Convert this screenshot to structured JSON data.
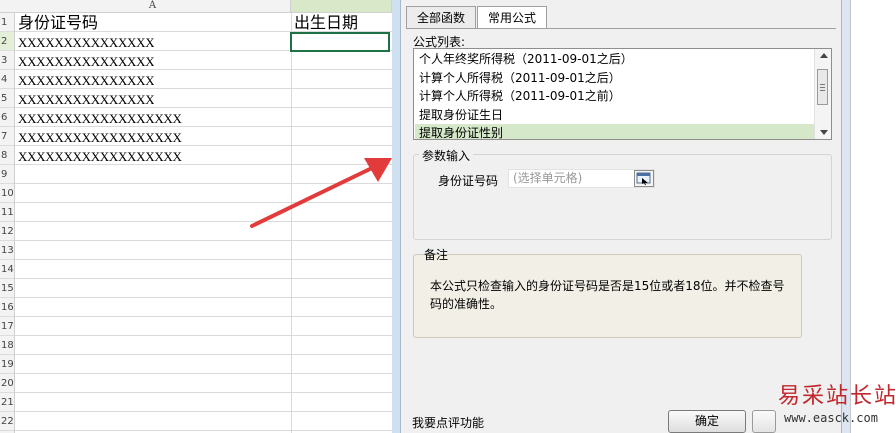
{
  "spreadsheet": {
    "columns": [
      {
        "label": "A",
        "selected": false
      },
      {
        "label": "",
        "selected": true
      }
    ],
    "rows": [
      {
        "num": "1",
        "selected": false
      },
      {
        "num": "2",
        "selected": true
      },
      {
        "num": "3",
        "selected": false
      },
      {
        "num": "4",
        "selected": false
      },
      {
        "num": "5",
        "selected": false
      },
      {
        "num": "6",
        "selected": false
      },
      {
        "num": "7",
        "selected": false
      },
      {
        "num": "8",
        "selected": false
      },
      {
        "num": "9",
        "selected": false
      },
      {
        "num": "10",
        "selected": false
      },
      {
        "num": "11",
        "selected": false
      },
      {
        "num": "12",
        "selected": false
      },
      {
        "num": "13",
        "selected": false
      },
      {
        "num": "14",
        "selected": false
      },
      {
        "num": "15",
        "selected": false
      },
      {
        "num": "16",
        "selected": false
      },
      {
        "num": "17",
        "selected": false
      },
      {
        "num": "18",
        "selected": false
      },
      {
        "num": "19",
        "selected": false
      },
      {
        "num": "20",
        "selected": false
      },
      {
        "num": "21",
        "selected": false
      },
      {
        "num": "22",
        "selected": false
      }
    ],
    "header_a": "身份证号码",
    "header_b": "出生日期",
    "id_values": [
      "XXXXXXXXXXXXXXX",
      "XXXXXXXXXXXXXXX",
      "XXXXXXXXXXXXXXX",
      "XXXXXXXXXXXXXXX",
      "XXXXXXXXXXXXXXXXXX",
      "XXXXXXXXXXXXXXXXXX",
      "XXXXXXXXXXXXXXXXXX"
    ],
    "active_cell_value": ""
  },
  "dialog": {
    "tabs": [
      {
        "label": "全部函数",
        "active": false
      },
      {
        "label": "常用公式",
        "active": true
      }
    ],
    "formula_list_label": "公式列表:",
    "formulas": [
      {
        "label": "个人年终奖所得税（2011-09-01之后）",
        "selected": false
      },
      {
        "label": "计算个人所得税（2011-09-01之后）",
        "selected": false
      },
      {
        "label": "计算个人所得税（2011-09-01之前）",
        "selected": false
      },
      {
        "label": "提取身份证生日",
        "selected": false
      },
      {
        "label": "提取身份证性别",
        "selected": true
      }
    ],
    "params_group_title": "参数输入",
    "param_label": "身份证号码",
    "param_placeholder": "(选择单元格)",
    "notes_title": "备注",
    "notes_text": "本公式只检查输入的身份证号码是否是15位或者18位。并不检查号码的准确性。",
    "feedback_link": "我要点评功能",
    "ok_button": "确定"
  },
  "watermark": {
    "text": "易采站长站",
    "url": "www.easck.com"
  },
  "colors": {
    "accent_green": "#1e7145",
    "selection_green": "#d5e8c9",
    "annotation_arrow": "#e23b3b",
    "watermark_red": "#c1272d"
  }
}
